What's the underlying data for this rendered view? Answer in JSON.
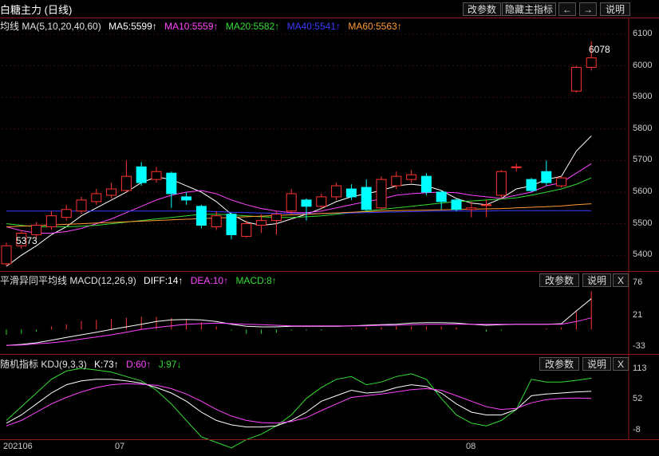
{
  "window": {
    "title": "白糖主力 (日线)",
    "buttons": [
      "改参数",
      "隐藏主指标",
      "←",
      "→",
      "说明"
    ]
  },
  "main_panel": {
    "legend": [
      {
        "text": "均线  MA(5,10,20,40,60)",
        "color": "#e0e0e0"
      },
      {
        "text": "MA5:5599↑",
        "color": "#ffffff"
      },
      {
        "text": "MA10:5559↑",
        "color": "#ff44ff"
      },
      {
        "text": "MA20:5582↑",
        "color": "#33dd33"
      },
      {
        "text": "MA40:5541↑",
        "color": "#3a3aff"
      },
      {
        "text": "MA60:5563↑",
        "color": "#ff9933"
      }
    ],
    "y_ticks": [
      "6100",
      "6000",
      "5900",
      "5800",
      "5700",
      "5600",
      "5500",
      "5400"
    ],
    "annotations": {
      "high": "6078",
      "low": "5373"
    }
  },
  "macd_panel": {
    "legend": [
      {
        "text": "平滑异同平均线  MACD(12,26,9)",
        "color": "#e0e0e0"
      },
      {
        "text": "DIFF:14↑",
        "color": "#ffffff"
      },
      {
        "text": "DEA:10↑",
        "color": "#ff44ff"
      },
      {
        "text": "MACD:8↑",
        "color": "#33dd33"
      }
    ],
    "buttons": [
      "改参数",
      "说明",
      "X"
    ],
    "y_ticks": [
      "76",
      "21",
      "-33"
    ]
  },
  "kdj_panel": {
    "legend": [
      {
        "text": "随机指标  KDJ(9,3,3)",
        "color": "#e0e0e0"
      },
      {
        "text": "K:73↑",
        "color": "#ffffff"
      },
      {
        "text": "D:60↑",
        "color": "#ff44ff"
      },
      {
        "text": "J:97↓",
        "color": "#33dd33"
      }
    ],
    "buttons": [
      "改参数",
      "说明",
      "X"
    ],
    "y_ticks": [
      "113",
      "52",
      "-8"
    ]
  },
  "x_axis": {
    "labels": [
      "202106",
      "07",
      "08"
    ]
  },
  "colors": {
    "up": "#ff3333",
    "down": "#00ffff",
    "separator": "#8b1a1a",
    "grid": "#3a0f0f"
  },
  "chart_data": [
    {
      "type": "candlestick",
      "title": "白糖主力 (日线)",
      "ylim": [
        5350,
        6120
      ],
      "candles": [
        {
          "o": 5373,
          "c": 5430,
          "h": 5440,
          "l": 5365
        },
        {
          "o": 5430,
          "c": 5470,
          "h": 5480,
          "l": 5420
        },
        {
          "o": 5465,
          "c": 5495,
          "h": 5505,
          "l": 5455
        },
        {
          "o": 5490,
          "c": 5525,
          "h": 5540,
          "l": 5480
        },
        {
          "o": 5520,
          "c": 5545,
          "h": 5560,
          "l": 5510
        },
        {
          "o": 5540,
          "c": 5575,
          "h": 5585,
          "l": 5530
        },
        {
          "o": 5570,
          "c": 5595,
          "h": 5610,
          "l": 5560
        },
        {
          "o": 5590,
          "c": 5610,
          "h": 5630,
          "l": 5580
        },
        {
          "o": 5605,
          "c": 5650,
          "h": 5700,
          "l": 5600
        },
        {
          "o": 5680,
          "c": 5630,
          "h": 5695,
          "l": 5620
        },
        {
          "o": 5640,
          "c": 5665,
          "h": 5680,
          "l": 5630
        },
        {
          "o": 5660,
          "c": 5595,
          "h": 5665,
          "l": 5550
        },
        {
          "o": 5585,
          "c": 5575,
          "h": 5600,
          "l": 5560
        },
        {
          "o": 5555,
          "c": 5495,
          "h": 5560,
          "l": 5485
        },
        {
          "o": 5490,
          "c": 5525,
          "h": 5540,
          "l": 5480
        },
        {
          "o": 5530,
          "c": 5465,
          "h": 5535,
          "l": 5450
        },
        {
          "o": 5460,
          "c": 5500,
          "h": 5510,
          "l": 5455
        },
        {
          "o": 5495,
          "c": 5510,
          "h": 5530,
          "l": 5470
        },
        {
          "o": 5510,
          "c": 5530,
          "h": 5540,
          "l": 5465
        },
        {
          "o": 5540,
          "c": 5595,
          "h": 5610,
          "l": 5530
        },
        {
          "o": 5575,
          "c": 5555,
          "h": 5580,
          "l": 5510
        },
        {
          "o": 5555,
          "c": 5585,
          "h": 5595,
          "l": 5545
        },
        {
          "o": 5585,
          "c": 5620,
          "h": 5630,
          "l": 5575
        },
        {
          "o": 5610,
          "c": 5585,
          "h": 5625,
          "l": 5575
        },
        {
          "o": 5615,
          "c": 5545,
          "h": 5640,
          "l": 5540
        },
        {
          "o": 5550,
          "c": 5640,
          "h": 5650,
          "l": 5545
        },
        {
          "o": 5620,
          "c": 5650,
          "h": 5665,
          "l": 5610
        },
        {
          "o": 5640,
          "c": 5655,
          "h": 5670,
          "l": 5630
        },
        {
          "o": 5650,
          "c": 5600,
          "h": 5660,
          "l": 5590
        },
        {
          "o": 5600,
          "c": 5570,
          "h": 5605,
          "l": 5545
        },
        {
          "o": 5575,
          "c": 5545,
          "h": 5580,
          "l": 5540
        },
        {
          "o": 5545,
          "c": 5550,
          "h": 5570,
          "l": 5520
        },
        {
          "o": 5560,
          "c": 5560,
          "h": 5575,
          "l": 5520
        },
        {
          "o": 5590,
          "c": 5665,
          "h": 5670,
          "l": 5580
        },
        {
          "o": 5680,
          "c": 5680,
          "h": 5690,
          "l": 5665
        },
        {
          "o": 5640,
          "c": 5605,
          "h": 5645,
          "l": 5600
        },
        {
          "o": 5665,
          "c": 5630,
          "h": 5700,
          "l": 5620
        },
        {
          "o": 5620,
          "c": 5645,
          "h": 5650,
          "l": 5615
        },
        {
          "o": 5920,
          "c": 5995,
          "h": 6000,
          "l": 5915
        },
        {
          "o": 5995,
          "c": 6025,
          "h": 6078,
          "l": 5985
        }
      ],
      "ma": {
        "MA5": [
          5365,
          5400,
          5430,
          5465,
          5490,
          5525,
          5550,
          5575,
          5600,
          5630,
          5648,
          5640,
          5620,
          5600,
          5570,
          5530,
          5505,
          5495,
          5500,
          5515,
          5530,
          5548,
          5570,
          5585,
          5595,
          5605,
          5620,
          5625,
          5620,
          5605,
          5580,
          5565,
          5560,
          5580,
          5610,
          5620,
          5640,
          5650,
          5730,
          5778
        ],
        "MA10": [
          5490,
          5478,
          5470,
          5470,
          5475,
          5485,
          5500,
          5515,
          5535,
          5555,
          5575,
          5590,
          5600,
          5605,
          5595,
          5575,
          5560,
          5548,
          5540,
          5535,
          5535,
          5540,
          5550,
          5560,
          5570,
          5578,
          5590,
          5595,
          5598,
          5600,
          5598,
          5590,
          5585,
          5580,
          5590,
          5600,
          5620,
          5630,
          5660,
          5690
        ],
        "MA20": [
          5500,
          5495,
          5490,
          5490,
          5490,
          5492,
          5495,
          5500,
          5505,
          5510,
          5515,
          5520,
          5525,
          5530,
          5530,
          5528,
          5525,
          5522,
          5520,
          5520,
          5522,
          5525,
          5530,
          5535,
          5540,
          5545,
          5550,
          5555,
          5560,
          5565,
          5570,
          5572,
          5575,
          5578,
          5582,
          5590,
          5600,
          5610,
          5625,
          5645
        ],
        "MA40": [
          5540,
          5540,
          5540,
          5540,
          5540,
          5540,
          5540,
          5540,
          5540,
          5540,
          5540,
          5540,
          5540,
          5540,
          5538,
          5536,
          5535,
          5534,
          5533,
          5532,
          5532,
          5532,
          5533,
          5534,
          5535,
          5536,
          5537,
          5538,
          5539,
          5540,
          5540,
          5540,
          5540,
          5541,
          5541,
          5541,
          5541,
          5541,
          5541,
          5541
        ],
        "MA60": [
          5490,
          5492,
          5494,
          5496,
          5498,
          5500,
          5502,
          5504,
          5506,
          5508,
          5510,
          5512,
          5514,
          5516,
          5518,
          5520,
          5522,
          5524,
          5526,
          5528,
          5530,
          5532,
          5534,
          5536,
          5538,
          5540,
          5541,
          5542,
          5543,
          5544,
          5545,
          5546,
          5547,
          5548,
          5550,
          5552,
          5554,
          5556,
          5560,
          5563
        ]
      }
    },
    {
      "type": "bar",
      "title": "MACD(12,26,9)",
      "ylim": [
        -40,
        80
      ],
      "DIFF": [
        -30,
        -28,
        -25,
        -20,
        -15,
        -10,
        -5,
        0,
        5,
        10,
        15,
        18,
        19,
        18,
        15,
        10,
        6,
        5,
        5,
        6,
        6,
        6,
        6,
        7,
        8,
        9,
        10,
        12,
        13,
        13,
        12,
        10,
        8,
        9,
        10,
        10,
        10,
        11,
        35,
        58
      ],
      "DEA": [
        -30,
        -29,
        -27,
        -25,
        -22,
        -18,
        -14,
        -10,
        -5,
        0,
        4,
        7,
        10,
        11,
        12,
        11,
        10,
        9,
        8,
        7,
        7,
        7,
        7,
        7,
        7,
        8,
        8,
        9,
        10,
        10,
        10,
        10,
        10,
        10,
        10,
        10,
        10,
        10,
        15,
        22
      ],
      "MACD": [
        -10,
        -8,
        -4,
        6,
        10,
        16,
        18,
        20,
        22,
        24,
        24,
        22,
        18,
        14,
        6,
        -2,
        -8,
        -8,
        -6,
        -2,
        -2,
        -2,
        0,
        2,
        4,
        4,
        6,
        6,
        6,
        6,
        4,
        0,
        -4,
        -2,
        0,
        0,
        2,
        4,
        34,
        72
      ]
    },
    {
      "type": "line",
      "title": "KDJ(9,3,3)",
      "ylim": [
        -10,
        115
      ],
      "K": [
        15,
        30,
        50,
        70,
        85,
        92,
        95,
        95,
        92,
        88,
        80,
        70,
        55,
        35,
        20,
        12,
        8,
        8,
        10,
        20,
        35,
        55,
        65,
        75,
        70,
        72,
        80,
        85,
        82,
        70,
        50,
        35,
        30,
        30,
        40,
        65,
        68,
        70,
        72,
        73
      ],
      "D": [
        10,
        20,
        35,
        50,
        62,
        72,
        80,
        85,
        87,
        86,
        84,
        78,
        68,
        55,
        40,
        28,
        20,
        16,
        15,
        18,
        25,
        38,
        50,
        62,
        65,
        68,
        72,
        76,
        78,
        75,
        65,
        55,
        45,
        40,
        42,
        52,
        58,
        60,
        61,
        60
      ],
      "J": [
        20,
        45,
        70,
        95,
        110,
        115,
        112,
        108,
        100,
        92,
        75,
        50,
        20,
        -10,
        -20,
        -30,
        -15,
        -5,
        10,
        30,
        60,
        80,
        95,
        100,
        85,
        90,
        100,
        105,
        95,
        60,
        30,
        15,
        10,
        20,
        40,
        95,
        90,
        90,
        93,
        97
      ]
    }
  ]
}
